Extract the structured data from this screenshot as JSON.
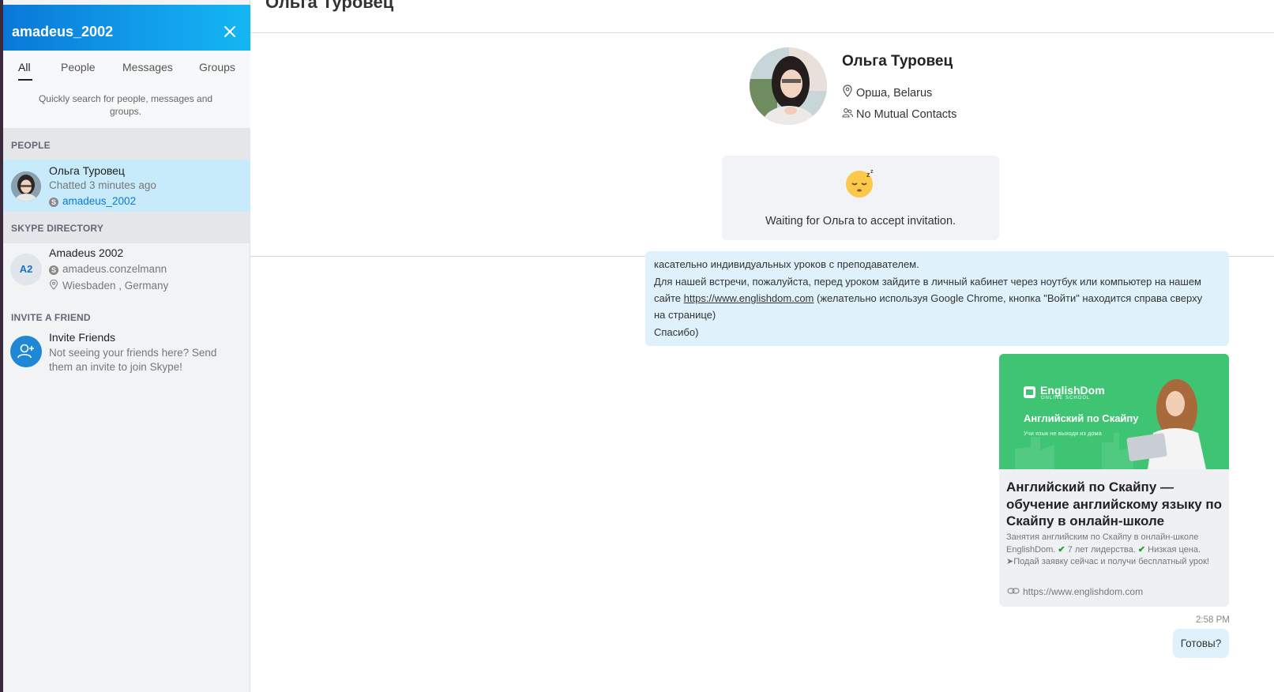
{
  "sidebar": {
    "header_title": "amadeus_2002",
    "tabs": [
      {
        "label": "All"
      },
      {
        "label": "People"
      },
      {
        "label": "Messages"
      },
      {
        "label": "Groups"
      }
    ],
    "hint": "Quickly search for people, messages and groups.",
    "sections": {
      "people": "PEOPLE",
      "directory": "SKYPE DIRECTORY",
      "invite": "INVITE A FRIEND"
    },
    "people_result": {
      "name": "Ольга Туровец",
      "status": "Chatted 3 minutes ago",
      "skype_id": "amadeus_2002"
    },
    "directory_result": {
      "initials": "A2",
      "name": "Amadeus 2002",
      "skype_id": "amadeus.conzelmann",
      "location": "Wiesbaden , Germany"
    },
    "invite": {
      "title": "Invite Friends",
      "line1": "Not seeing your friends here? Send",
      "line2": "them an invite to join Skype!"
    }
  },
  "main": {
    "title": "Ольга Туровец",
    "profile": {
      "name": "Ольга Туровец",
      "location": "Орша, Belarus",
      "mutual": "No Mutual Contacts"
    },
    "waiting": {
      "text": "Waiting for Ольга to accept invitation."
    },
    "message": {
      "line1": "касательно индивидуальных уроков с преподавателем.",
      "line2": "Для нашей встречи, пожалуйста, перед уроком зайдите в личный кабинет через ноутбук или компьютер на нашем",
      "line3_pre": "сайте ",
      "line3_link": "https://www.englishdom.com",
      "line3_post": " (желательно используя Google Chrome, кнопка \"Войти\" находится справа сверху",
      "line4": "на странице)",
      "line5": "Спасибо)"
    },
    "link_preview": {
      "image_brand": "EnglishDom",
      "image_brand_sub": "ONLINE SCHOOL",
      "image_headline": "Английский по Скайпу",
      "image_tagline": "Учи язык не выходя из дома",
      "title": "Английский по Скайпу — обучение английскому языку по Скайпу в онлайн-школе",
      "desc_1": "Занятия английским по Скайпу в онлайн-школе EnglishDom.",
      "desc_2": "7 лет лидерства.",
      "desc_3": "Низкая цена. ➤Подай заявку сейчас и получи бесплатный урок!",
      "url": "https://www.englishdom.com"
    },
    "time": "2:58 PM",
    "last_message": "Готовы?"
  },
  "colors": {
    "brand_blue": "#0a78d7",
    "selected_row": "#c7ebfb",
    "bubble": "#dff2fb",
    "preview_green": "#3dc574"
  }
}
